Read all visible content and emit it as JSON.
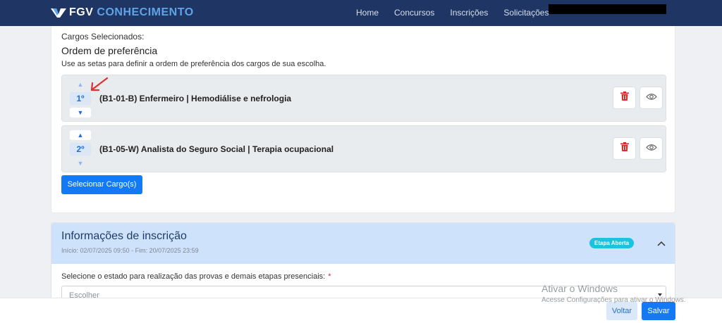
{
  "header": {
    "logo_brand": "FGV",
    "logo_product": "CONHECIMENTO",
    "nav": [
      "Home",
      "Concursos",
      "Inscrições",
      "Solicitações"
    ]
  },
  "cargos": {
    "selected_label": "Cargos Selecionados:",
    "order_heading": "Ordem de preferência",
    "hint": "Use as setas para definir a ordem de preferência dos cargos de sua escolha.",
    "items": [
      {
        "order": "1º",
        "title": "(B1-01-B) Enfermeiro | Hemodiálise e nefrologia"
      },
      {
        "order": "2º",
        "title": "(B1-05-W) Analista do Seguro Social | Terapia ocupacional"
      }
    ],
    "up_glyph": "▲",
    "down_glyph": "▼",
    "select_button": "Selecionar Cargo(s)"
  },
  "inscricao": {
    "title": "Informações de inscrição",
    "dates": "Início: 02/07/2025 09:50 - Fim: 20/07/2025 23:59",
    "badge": "Etapa Aberta",
    "state_label": "Selecione o estado para realização das provas e demais etapas presenciais:",
    "required_mark": "*",
    "state_placeholder": "Escolher"
  },
  "footer": {
    "back": "Voltar",
    "save": "Salvar"
  },
  "watermark": {
    "title": "Ativar o Windows",
    "subtitle": "Acesse Configurações para ativar o Windows."
  },
  "colors": {
    "navbar": "#1f3563",
    "brand_accent": "#5fa4e6",
    "primary": "#1479f5",
    "danger": "#d62d2d",
    "badge": "#1ec1e0"
  },
  "icons": {
    "delete": "trash-icon",
    "view": "eye-icon",
    "collapse": "chevron-up-icon",
    "annotation": "red-arrow-annotation"
  }
}
